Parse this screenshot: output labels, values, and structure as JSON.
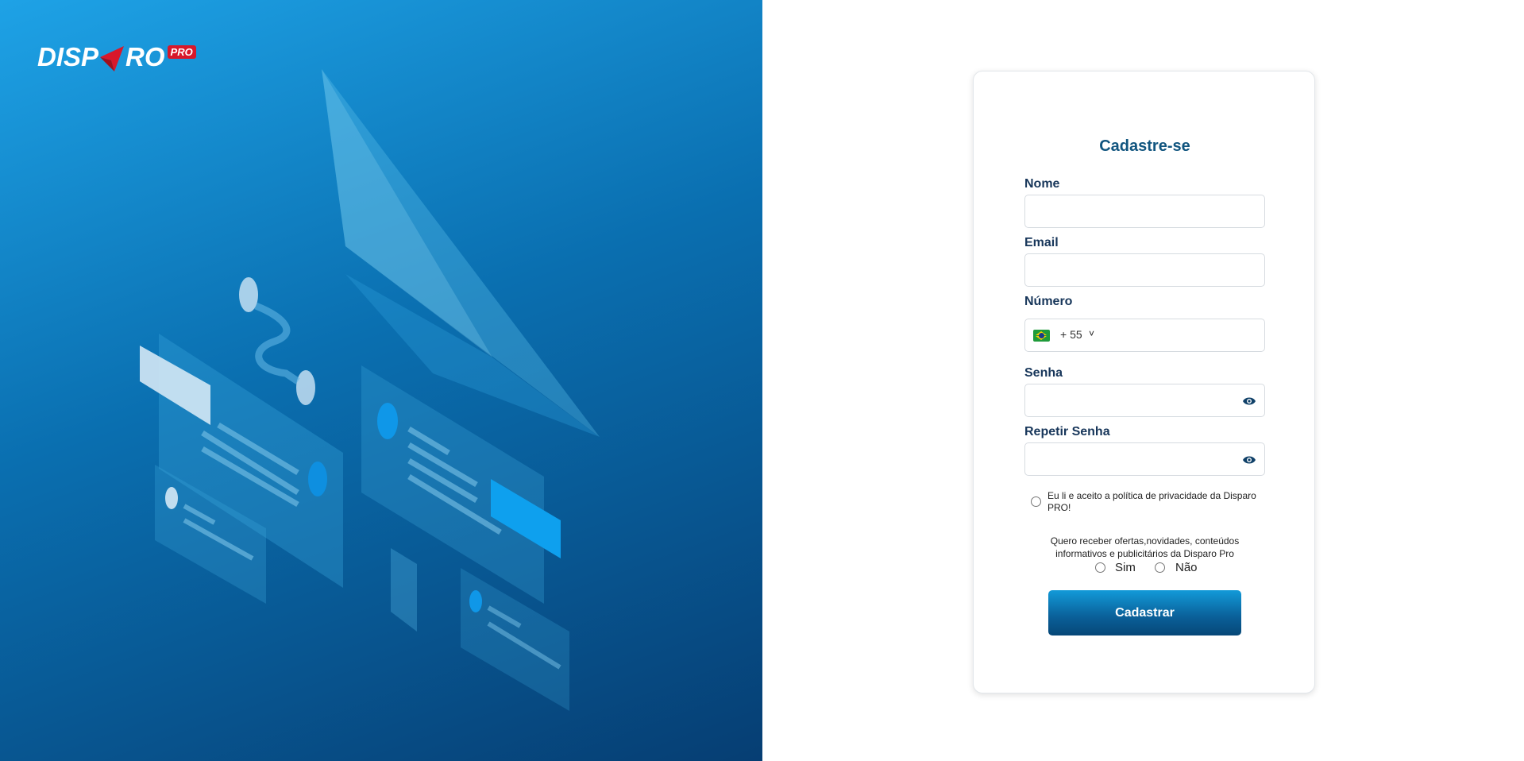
{
  "brand": {
    "wordmark_part1": "DISP",
    "wordmark_part2": "RO",
    "badge": "PRO",
    "accent_red": "#d8182a"
  },
  "form": {
    "title": "Cadastre-se",
    "fields": {
      "name_label": "Nome",
      "email_label": "Email",
      "phone_label": "Número",
      "phone_country_flag": "brazil-flag-icon",
      "phone_dial_code": "+ 55",
      "password_label": "Senha",
      "repeat_password_label": "Repetir Senha"
    },
    "privacy_consent": "Eu li e aceito a política de privacidade da Disparo PRO!",
    "offers_question": "Quero receber ofertas,novidades, conteúdos informativos e publicitários da Disparo Pro",
    "offers_options": {
      "yes": "Sim",
      "no": "Não"
    },
    "submit_label": "Cadastrar"
  },
  "colors": {
    "hero_top": "#1ea2e6",
    "hero_bottom": "#063e73",
    "title": "#11557f",
    "label": "#17365a",
    "button": "#0a5f98"
  }
}
